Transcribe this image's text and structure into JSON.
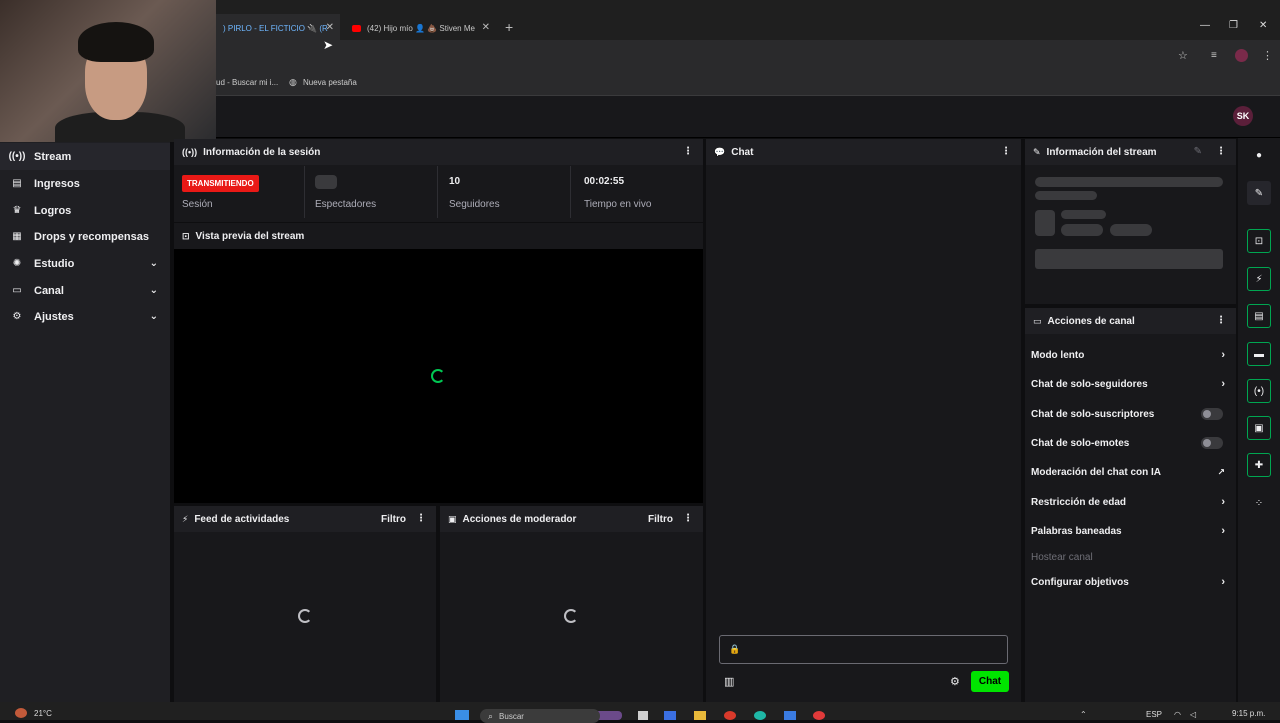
{
  "browser": {
    "tabs": [
      {
        "title": ") PIRLO - EL FICTICIO 🔌 (R"
      },
      {
        "title": "(42) Hijo mío 👤 💩 Stiven Me"
      }
    ],
    "bookmarks": [
      "ud - Buscar mi i...",
      "Nueva pestaña"
    ]
  },
  "header": {
    "avatar_initials": "SK"
  },
  "nav": {
    "items": [
      {
        "label": "Stream",
        "icon": "broadcast-icon"
      },
      {
        "label": "Ingresos",
        "icon": "money-icon"
      },
      {
        "label": "Logros",
        "icon": "trophy-icon"
      },
      {
        "label": "Drops y recompensas",
        "icon": "gift-icon"
      },
      {
        "label": "Estudio",
        "icon": "gear-icon"
      },
      {
        "label": "Canal",
        "icon": "channel-icon"
      },
      {
        "label": "Ajustes",
        "icon": "gear-icon"
      }
    ]
  },
  "session": {
    "title": "Información de la sesión",
    "status_badge": "TRANSMITIENDO",
    "session_label": "Sesión",
    "viewers_label": "Espectadores",
    "followers_value": "10",
    "followers_label": "Seguidores",
    "live_time_value": "00:02:55",
    "live_time_label": "Tiempo en vivo"
  },
  "preview": {
    "title": "Vista previa del stream"
  },
  "activity": {
    "title": "Feed de actividades",
    "filter": "Filtro"
  },
  "modactions": {
    "title": "Acciones de moderador",
    "filter": "Filtro"
  },
  "chat": {
    "title": "Chat",
    "send_label": "Chat"
  },
  "streaminfo": {
    "title": "Información del stream"
  },
  "channel_actions": {
    "title": "Acciones de canal",
    "items": [
      {
        "label": "Modo lento"
      },
      {
        "label": "Chat de solo-seguidores"
      },
      {
        "label": "Chat de solo-suscriptores"
      },
      {
        "label": "Chat de solo-emotes"
      },
      {
        "label": "Moderación del chat con IA"
      },
      {
        "label": "Restricción de edad"
      },
      {
        "label": "Palabras baneadas"
      },
      {
        "label": "Hostear canal"
      },
      {
        "label": "Configurar objetivos"
      }
    ]
  },
  "taskbar": {
    "weather": "21°C",
    "search_label": "Buscar",
    "language": "ESP",
    "time": "9:15 p.m."
  },
  "colors": {
    "accent": "#9147ff",
    "live": "#e91916",
    "chat_button": "#00e400",
    "rail_border": "#00a651"
  }
}
